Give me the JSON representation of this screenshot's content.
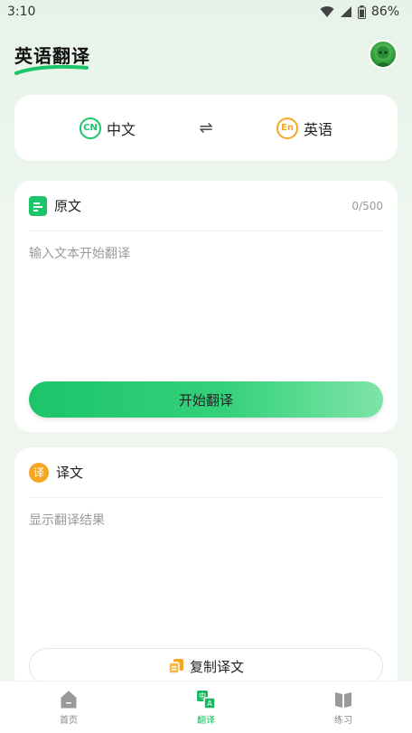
{
  "status_bar": {
    "time": "3:10",
    "battery": "86%"
  },
  "header": {
    "title": "英语翻译"
  },
  "languages": {
    "source": {
      "badge": "CN",
      "label": "中文",
      "color": "#1cc46a"
    },
    "target": {
      "badge": "En",
      "label": "英语",
      "color": "#f5a623"
    },
    "swap_symbol": "⇌"
  },
  "source_panel": {
    "title": "原文",
    "count": "0/500",
    "placeholder": "输入文本开始翻译",
    "button_label": "开始翻译"
  },
  "result_panel": {
    "badge": "译",
    "title": "译文",
    "placeholder": "显示翻译结果",
    "copy_label": "复制译文"
  },
  "nav": {
    "items": [
      {
        "label": "首页",
        "icon": "home-icon",
        "active": false
      },
      {
        "label": "翻译",
        "icon": "translate-icon",
        "active": true
      },
      {
        "label": "练习",
        "icon": "book-icon",
        "active": false
      }
    ]
  },
  "colors": {
    "accent": "#1cc46a",
    "orange": "#f5a623",
    "background": "#eef6ef"
  }
}
